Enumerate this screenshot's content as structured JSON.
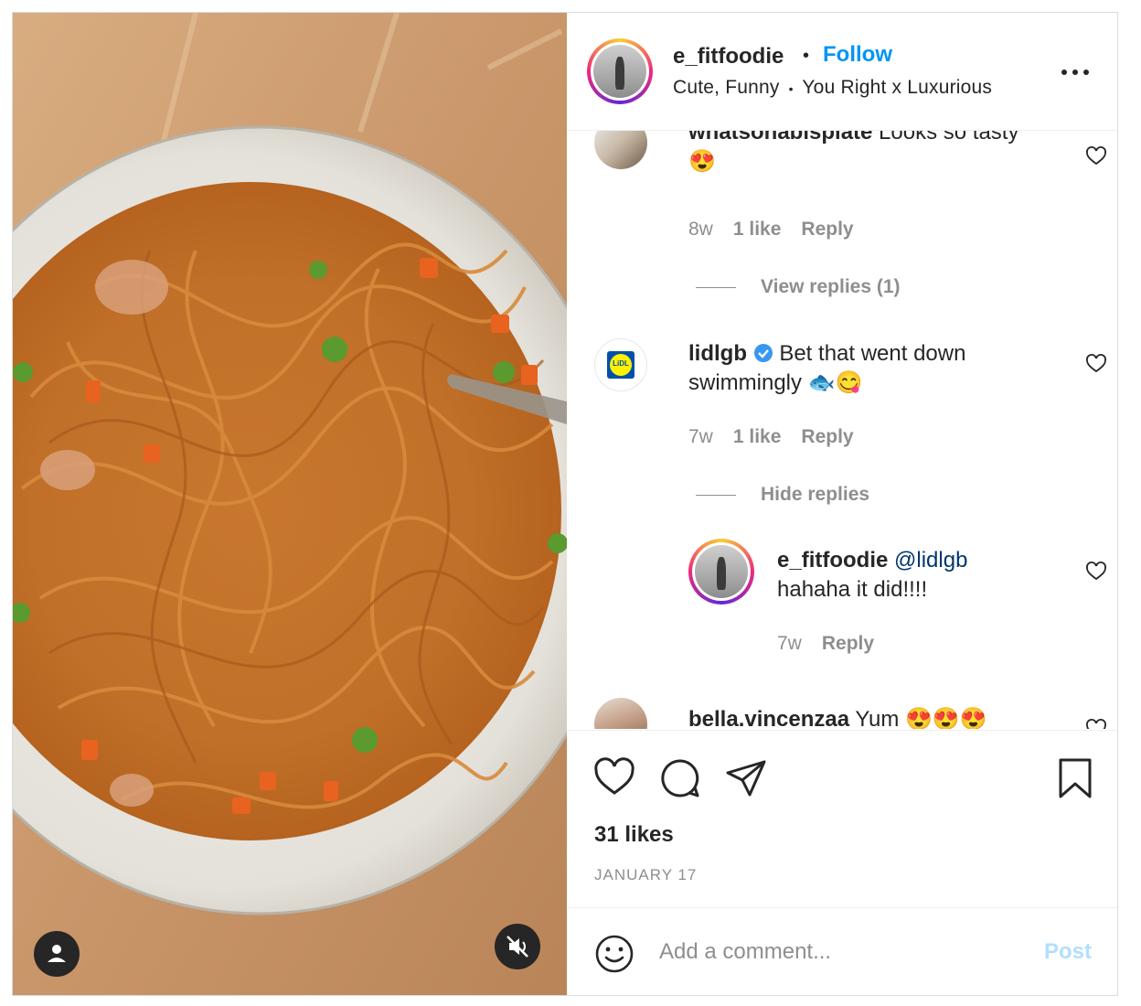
{
  "header": {
    "username": "e_fitfoodie",
    "separator": "•",
    "follow_label": "Follow",
    "audio_line": "Cute, Funny",
    "song": "You Right x Luxurious",
    "more_label": "•••"
  },
  "comments": [
    {
      "username": "whatsonabisplate",
      "text": "Looks so tasty",
      "emoji": "😍",
      "time": "8w",
      "likes": "1 like",
      "reply_label": "Reply",
      "view_replies": "View replies (1)"
    },
    {
      "username": "lidlgb",
      "verified": true,
      "avatar_text": "LiDL",
      "text_line1": "Bet that went down",
      "text_line2": "swimmingly",
      "emoji": "🐟😋",
      "time": "7w",
      "likes": "1 like",
      "reply_label": "Reply",
      "hide_replies": "Hide replies",
      "reply": {
        "username": "e_fitfoodie",
        "mention": "@lidlgb",
        "text": "hahaha it did!!!!",
        "time": "7w",
        "reply_label": "Reply"
      }
    },
    {
      "username": "bella.vincenzaa",
      "text": "Yum",
      "emoji": "😍😍😍"
    }
  ],
  "actions": {
    "likes": "31 likes",
    "date": "JANUARY 17"
  },
  "add_comment": {
    "placeholder": "Add a comment...",
    "post_label": "Post"
  },
  "colors": {
    "link": "#0095f6",
    "muted": "#8e8e8e",
    "post_disabled": "#b2dffc",
    "verified": "#3897f0"
  }
}
